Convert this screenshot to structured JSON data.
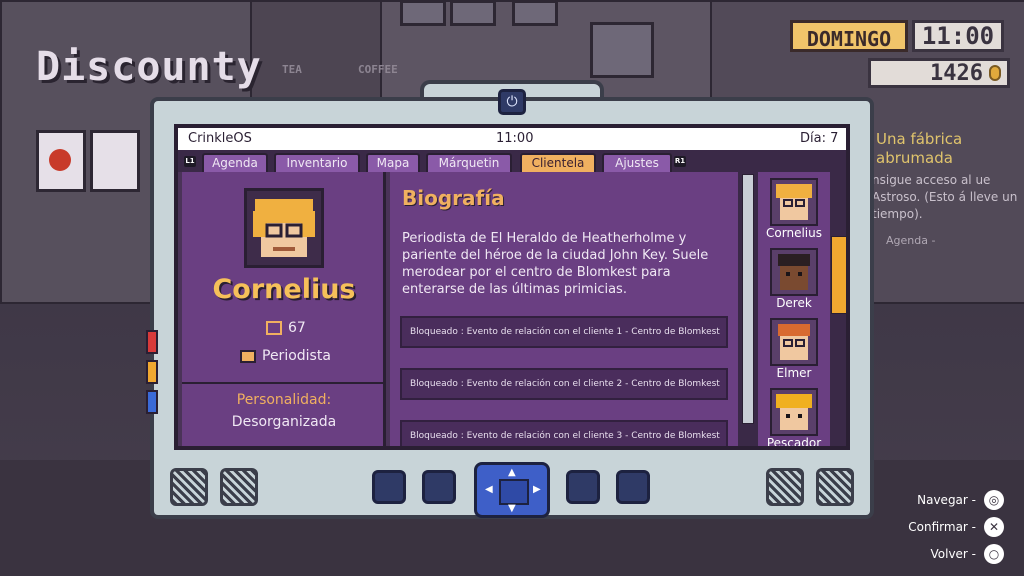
{
  "background": {
    "store_sign": "Discounty",
    "sign_tea": "TEA",
    "sign_coffee": "COFFEE"
  },
  "hud": {
    "day": "DOMINGO",
    "time": "11:00",
    "money": "1426"
  },
  "quest": {
    "title": "Una fábrica abrumada",
    "text": "nsigue acceso al ue Astroso. (Esto á lleve un tiempo).",
    "agenda": "Agenda -"
  },
  "device": {
    "os_name": "CrinkleOS",
    "time": "11:00",
    "day_label": "Día: 7",
    "left_hint": "L1",
    "right_hint": "R1",
    "tabs": [
      "Agenda",
      "Inventario",
      "Mapa",
      "Márquetin",
      "Clientela",
      "Ajustes"
    ],
    "active_tab": "Clientela"
  },
  "profile": {
    "name": "Cornelius",
    "visits": "67",
    "job": "Periodista",
    "personality_label": "Personalidad:",
    "personality": "Desorganizada"
  },
  "bio": {
    "title": "Biografía",
    "text": "Periodista de El Heraldo de Heatherholme y pariente del héroe de la ciudad John Key. Suele merodear por el centro de Blomkest para enterarse de las últimas primicias.",
    "events": [
      "Bloqueado : Evento de relación con el cliente 1 - Centro de Blomkest",
      "Bloqueado : Evento de relación con el cliente 2 - Centro de Blomkest",
      "Bloqueado : Evento de relación con el cliente 3 - Centro de Blomkest"
    ]
  },
  "clients": [
    {
      "name": "Cornelius"
    },
    {
      "name": "Derek"
    },
    {
      "name": "Elmer"
    },
    {
      "name": "Pescador"
    }
  ],
  "legend": {
    "navigate": "Navegar -",
    "confirm": "Confirmar -",
    "back": "Volver -"
  },
  "colors": {
    "screen_purple": "#6a3f82",
    "accent_orange": "#f0b060",
    "name_gold": "#f6c05a"
  }
}
